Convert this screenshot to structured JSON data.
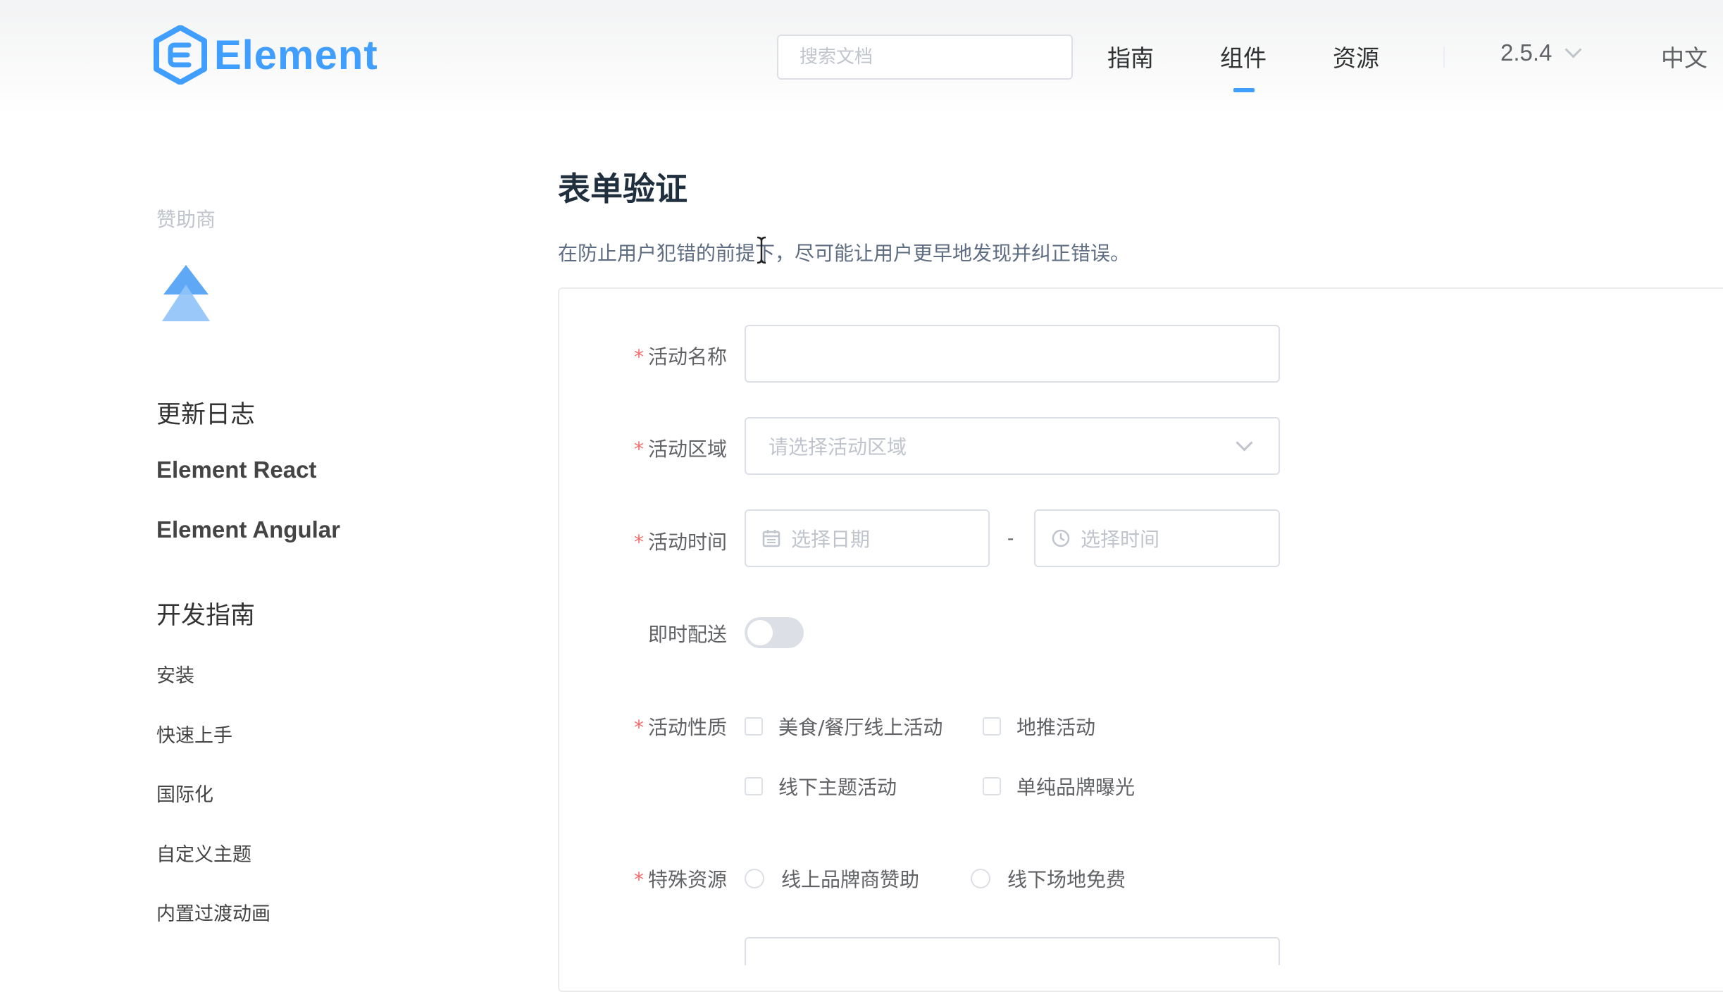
{
  "header": {
    "logo_text": "Element",
    "search_placeholder": "搜索文档",
    "nav": [
      "指南",
      "组件",
      "资源"
    ],
    "active_nav": "组件",
    "version": "2.5.4",
    "language": "中文",
    "accent_color": "#409eff"
  },
  "sidebar": {
    "sponsor_label": "赞助商",
    "changelog": "更新日志",
    "link_react": "Element React",
    "link_angular": "Element Angular",
    "dev_guide": "开发指南",
    "guide_items": [
      "安装",
      "快速上手",
      "国际化",
      "自定义主题",
      "内置过渡动画"
    ]
  },
  "main": {
    "title": "表单验证",
    "description": "在防止用户犯错的前提下，尽可能让用户更早地发现并纠正错误。",
    "form": {
      "name_label": "活动名称",
      "name_value": "",
      "region_label": "活动区域",
      "region_placeholder": "请选择活动区域",
      "time_label": "活动时间",
      "date_placeholder": "选择日期",
      "time_placeholder": "选择时间",
      "time_separator": "-",
      "delivery_label": "即时配送",
      "delivery_on": false,
      "type_label": "活动性质",
      "type_options": [
        "美食/餐厅线上活动",
        "地推活动",
        "线下主题活动",
        "单纯品牌曝光"
      ],
      "resource_label": "特殊资源",
      "resource_options": [
        "线上品牌商赞助",
        "线下场地免费"
      ],
      "required_mark": "*"
    }
  }
}
